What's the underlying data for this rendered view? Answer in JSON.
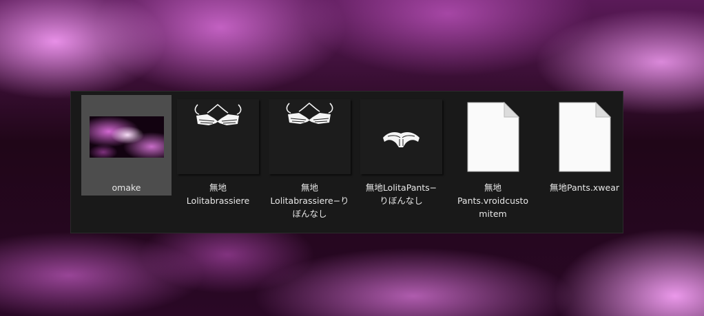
{
  "window": {
    "items": [
      {
        "label": "omake",
        "kind": "folder",
        "icon": "folder-preview-icon",
        "selected": true
      },
      {
        "label": "無地\nLolitabrassiere",
        "kind": "texture",
        "icon": "brassiere-thumbnail-icon"
      },
      {
        "label": "無地\nLolitabrassiere−り\nぼんなし",
        "kind": "texture",
        "icon": "brassiere-thumbnail-icon"
      },
      {
        "label": "無地LolitaPants−\nりぼんなし",
        "kind": "texture",
        "icon": "pants-thumbnail-icon"
      },
      {
        "label": "無地\nPants.vroidcusto\nmitem",
        "kind": "file",
        "icon": "document-icon"
      },
      {
        "label": "無地Pants.xwear",
        "kind": "file",
        "icon": "document-icon"
      }
    ]
  },
  "colors": {
    "window_bg": "#191919",
    "selection_bg": "#4d4d4d",
    "label_text": "#e8e8e8",
    "accent_pink": "#e98ce9"
  }
}
